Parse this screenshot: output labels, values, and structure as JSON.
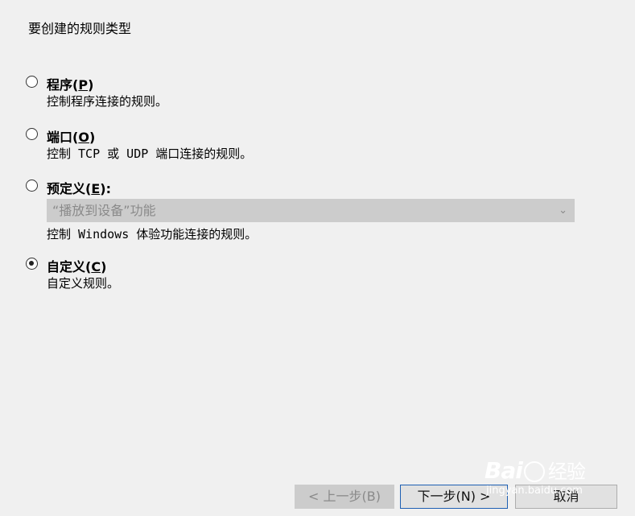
{
  "dialog": {
    "heading": "要创建的规则类型"
  },
  "options": [
    {
      "label": "程序(",
      "mnemonic": "P",
      "label_end": ")",
      "desc": "控制程序连接的规则。",
      "checked": false
    },
    {
      "label": "端口(",
      "mnemonic": "O",
      "label_end": ")",
      "desc": "控制 TCP 或 UDP 端口连接的规则。",
      "checked": false
    },
    {
      "label": "预定义(",
      "mnemonic": "E",
      "label_end": "):",
      "desc": "控制 Windows 体验功能连接的规则。",
      "checked": false
    },
    {
      "label": "自定义(",
      "mnemonic": "C",
      "label_end": ")",
      "desc": "自定义规则。",
      "checked": true
    }
  ],
  "predefined_select": {
    "value": "“播放到设备”功能",
    "arrow": "⌄"
  },
  "buttons": {
    "back": "< 上一步(B)",
    "next": "下一步(N) >",
    "cancel": "取消"
  },
  "watermark": {
    "logo_a": "Bai",
    "logo_cn": "经验",
    "url": "jingyan.baidu.com"
  }
}
